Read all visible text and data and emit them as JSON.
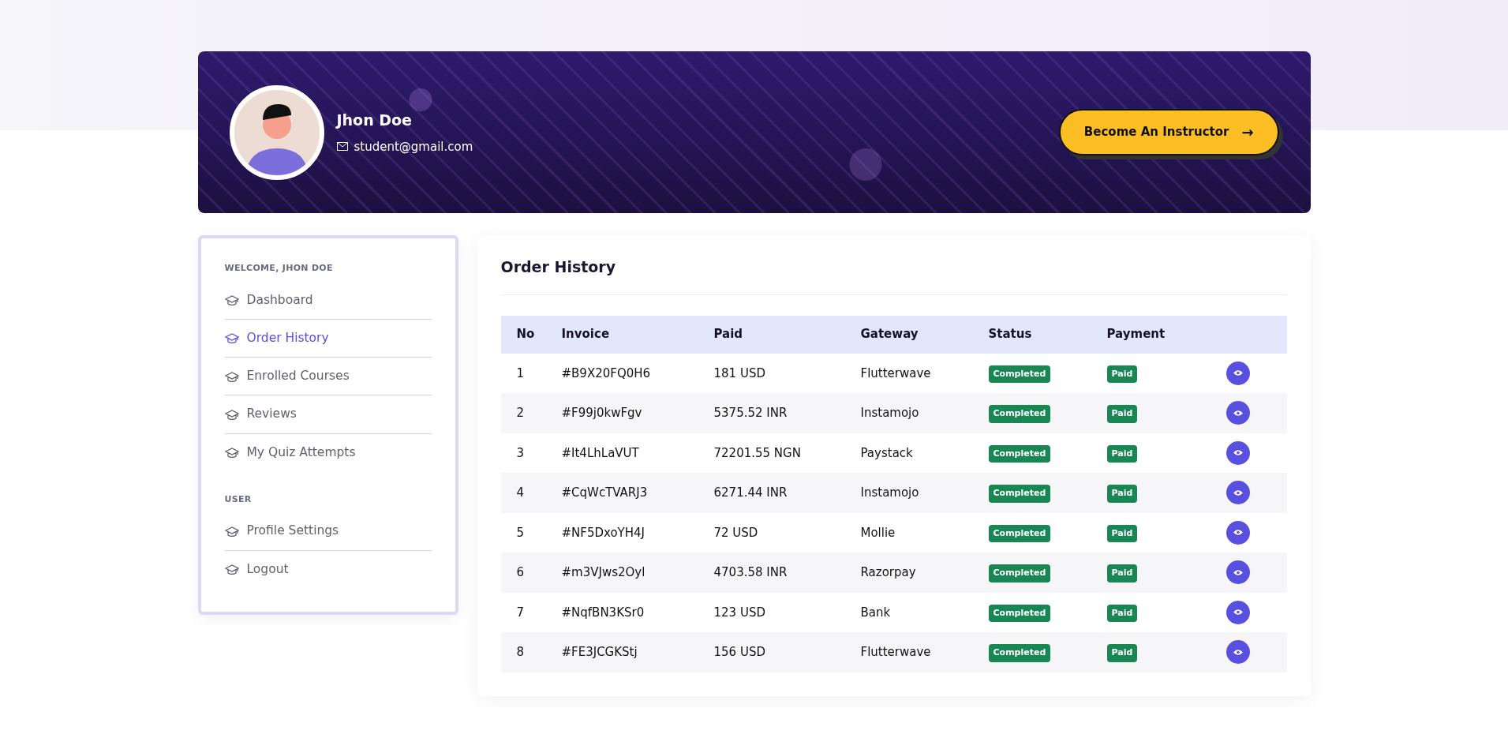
{
  "profile": {
    "name": "Jhon Doe",
    "email": "student@gmail.com"
  },
  "cta_button": {
    "label": "Become An Instructor",
    "arrow": "→"
  },
  "sidebar": {
    "sections": [
      {
        "heading": "WELCOME, JHON DOE",
        "items": [
          {
            "label": "Dashboard",
            "selected": false
          },
          {
            "label": "Order History",
            "selected": true
          },
          {
            "label": "Enrolled Courses",
            "selected": false
          },
          {
            "label": "Reviews",
            "selected": false
          },
          {
            "label": "My Quiz Attempts",
            "selected": false
          }
        ]
      },
      {
        "heading": "USER",
        "items": [
          {
            "label": "Profile Settings",
            "selected": false
          },
          {
            "label": "Logout",
            "selected": false
          }
        ]
      }
    ]
  },
  "order_history": {
    "title": "Order History",
    "columns": [
      "No",
      "Invoice",
      "Paid",
      "Gateway",
      "Status",
      "Payment"
    ],
    "rows": [
      {
        "no": "1",
        "invoice": "#B9X20FQ0H6",
        "paid": "181 USD",
        "gateway": "Flutterwave",
        "status": "Completed",
        "payment": "Paid"
      },
      {
        "no": "2",
        "invoice": "#F99j0kwFgv",
        "paid": "5375.52 INR",
        "gateway": "Instamojo",
        "status": "Completed",
        "payment": "Paid"
      },
      {
        "no": "3",
        "invoice": "#It4LhLaVUT",
        "paid": "72201.55 NGN",
        "gateway": "Paystack",
        "status": "Completed",
        "payment": "Paid"
      },
      {
        "no": "4",
        "invoice": "#CqWcTVARJ3",
        "paid": "6271.44 INR",
        "gateway": "Instamojo",
        "status": "Completed",
        "payment": "Paid"
      },
      {
        "no": "5",
        "invoice": "#NF5DxoYH4J",
        "paid": "72 USD",
        "gateway": "Mollie",
        "status": "Completed",
        "payment": "Paid"
      },
      {
        "no": "6",
        "invoice": "#m3VJws2Oyl",
        "paid": "4703.58 INR",
        "gateway": "Razorpay",
        "status": "Completed",
        "payment": "Paid"
      },
      {
        "no": "7",
        "invoice": "#NqfBN3KSr0",
        "paid": "123 USD",
        "gateway": "Bank",
        "status": "Completed",
        "payment": "Paid"
      },
      {
        "no": "8",
        "invoice": "#FE3JCGKStj",
        "paid": "156 USD",
        "gateway": "Flutterwave",
        "status": "Completed",
        "payment": "Paid"
      }
    ]
  }
}
